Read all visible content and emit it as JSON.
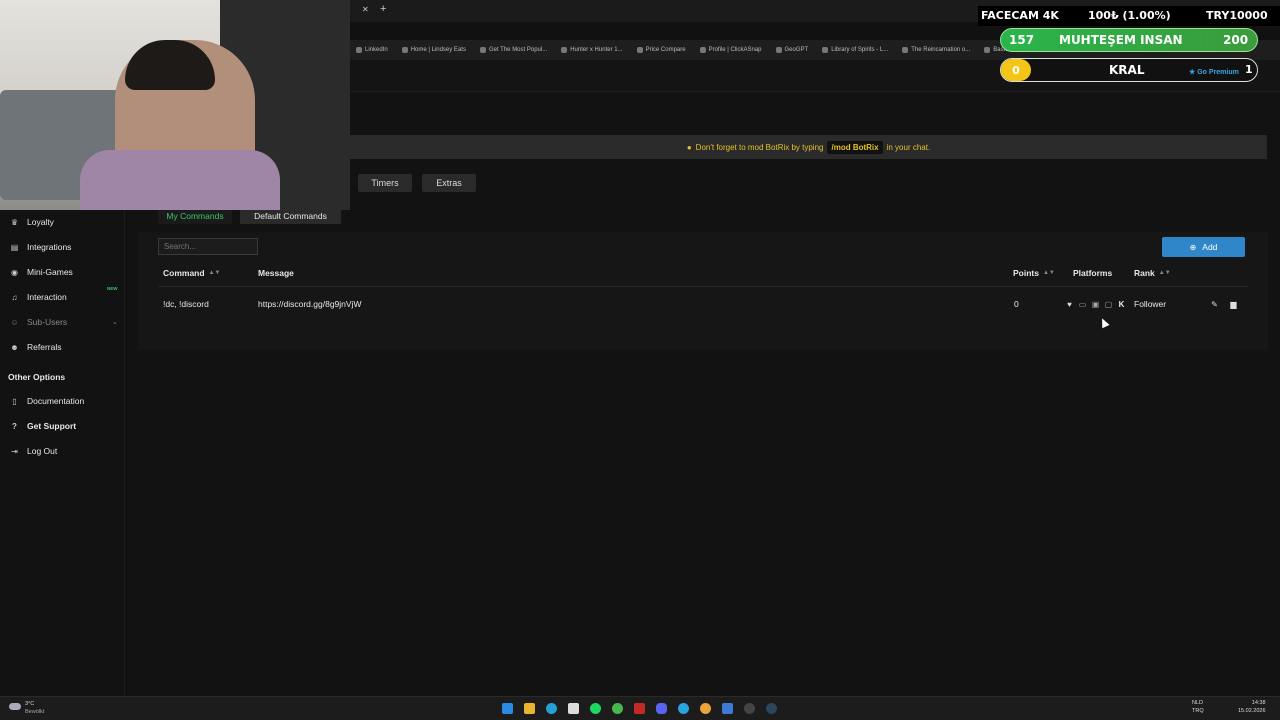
{
  "browser": {
    "new_tab": "+",
    "bookmarks": [
      "LinkedIn",
      "Home | Lindsey Eats",
      "Get The Most Popul...",
      "Hunter x Hunter 1...",
      "Price Compare",
      "Profile | ClickASnap",
      "GeoGPT",
      "Library of Spirits - L...",
      "The Reincarnation o...",
      "Basics of Online M..."
    ]
  },
  "overlay": {
    "facecam": "FACECAM 4K",
    "progress_text": "100₺ (1.00%)",
    "goal": "TRY10000",
    "count_left": "157",
    "name_top": "MUHTEŞEM INSAN",
    "count_right": "200",
    "count_bottom": "0",
    "name_bottom": "KRAL",
    "premium": "Go Premium",
    "bottom_right": "1"
  },
  "notice": {
    "text_before": "Don't forget to mod BotRix by typing",
    "command": "/mod BotRix",
    "text_after": "in your chat."
  },
  "tabs": [
    "Timers",
    "Extras"
  ],
  "subtabs": [
    "My Commands",
    "Default Commands"
  ],
  "sidebar": {
    "items": [
      "Loyalty",
      "Integrations",
      "Mini-Games",
      "Interaction",
      "Sub-Users",
      "Referrals"
    ],
    "new_badge": "NEW",
    "section": "Other Options",
    "other_items": [
      "Documentation",
      "Get Support",
      "Log Out"
    ]
  },
  "search": {
    "placeholder": "Search..."
  },
  "add_button": "Add",
  "table": {
    "headers": {
      "command": "Command",
      "message": "Message",
      "points": "Points",
      "platforms": "Platforms",
      "rank": "Rank"
    },
    "rows": [
      {
        "command": "!dc, !discord",
        "message": "https://discord.gg/8g9jnVjW",
        "points": "0",
        "rank": "Follower"
      }
    ]
  },
  "taskbar": {
    "weather_temp": "3°C",
    "weather_desc": "Bewölkt",
    "lang_top": "NLD",
    "lang_bottom": "TRQ",
    "time": "14:38",
    "date": "15.02.2026"
  },
  "colors": {
    "accent": "#2f87c9",
    "notice": "#e6c02c",
    "active_tab": "#3cc46a",
    "new_badge": "#3cc46a"
  }
}
